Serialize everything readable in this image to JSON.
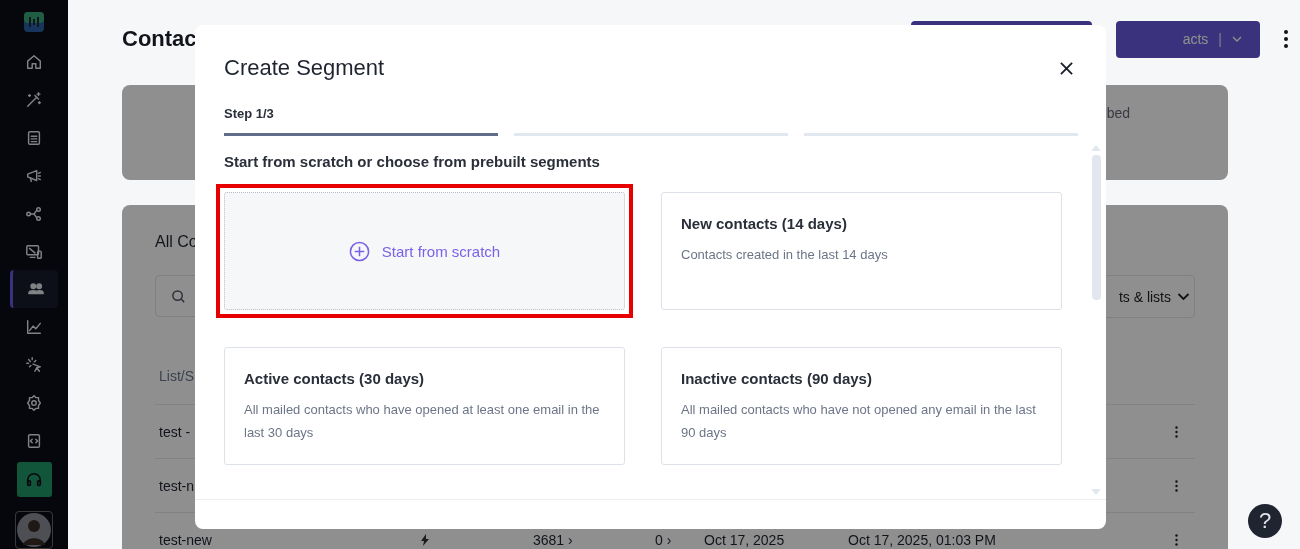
{
  "sidebar": {
    "items": [
      {
        "kind": "home",
        "selected": false
      },
      {
        "kind": "wand",
        "selected": false
      },
      {
        "kind": "document",
        "selected": false
      },
      {
        "kind": "megaphone",
        "selected": false
      },
      {
        "kind": "nodes",
        "selected": false
      },
      {
        "kind": "devices",
        "selected": false
      },
      {
        "kind": "people",
        "selected": true
      },
      {
        "kind": "chart",
        "selected": false
      },
      {
        "kind": "cursor",
        "selected": false
      },
      {
        "kind": "gear",
        "selected": false
      },
      {
        "kind": "code",
        "selected": false
      }
    ]
  },
  "page": {
    "title": "Contac",
    "action_button": {
      "label": "acts",
      "separator": "|"
    },
    "summary_card": {
      "text": "bed"
    },
    "list_card": {
      "title": "All Co",
      "filter": {
        "label": "ts & lists"
      },
      "table": {
        "header": "List/S",
        "rows": [
          {
            "name": "test -",
            "cells": []
          },
          {
            "name": "test-n",
            "cells": []
          },
          {
            "name": "test-new",
            "cells": [
              "3681 ›",
              "0 ›",
              "Oct 17, 2025",
              "Oct 17, 2025, 01:03 PM"
            ]
          }
        ]
      }
    }
  },
  "modal": {
    "title": "Create Segment",
    "step": "Step 1/3",
    "steps": [
      {
        "done": true
      },
      {
        "done": false
      },
      {
        "done": false
      }
    ],
    "heading": "Start from scratch or choose from prebuilt segments",
    "options": [
      {
        "kind": "scratch",
        "label": "Start from scratch",
        "highlighted": true
      },
      {
        "kind": "preset",
        "title": "New contacts (14 days)",
        "description": "Contacts created in the last 14 days",
        "highlighted": false
      },
      {
        "kind": "preset",
        "title": "Active contacts (30 days)",
        "description": "All mailed contacts who have opened at least one email in the last 30 days",
        "highlighted": false
      },
      {
        "kind": "preset",
        "title": "Inactive contacts (90 days)",
        "description": "All mailed contacts who have not opened any email in the last 90 days",
        "highlighted": false
      }
    ]
  },
  "help_button": {
    "label": "?"
  }
}
